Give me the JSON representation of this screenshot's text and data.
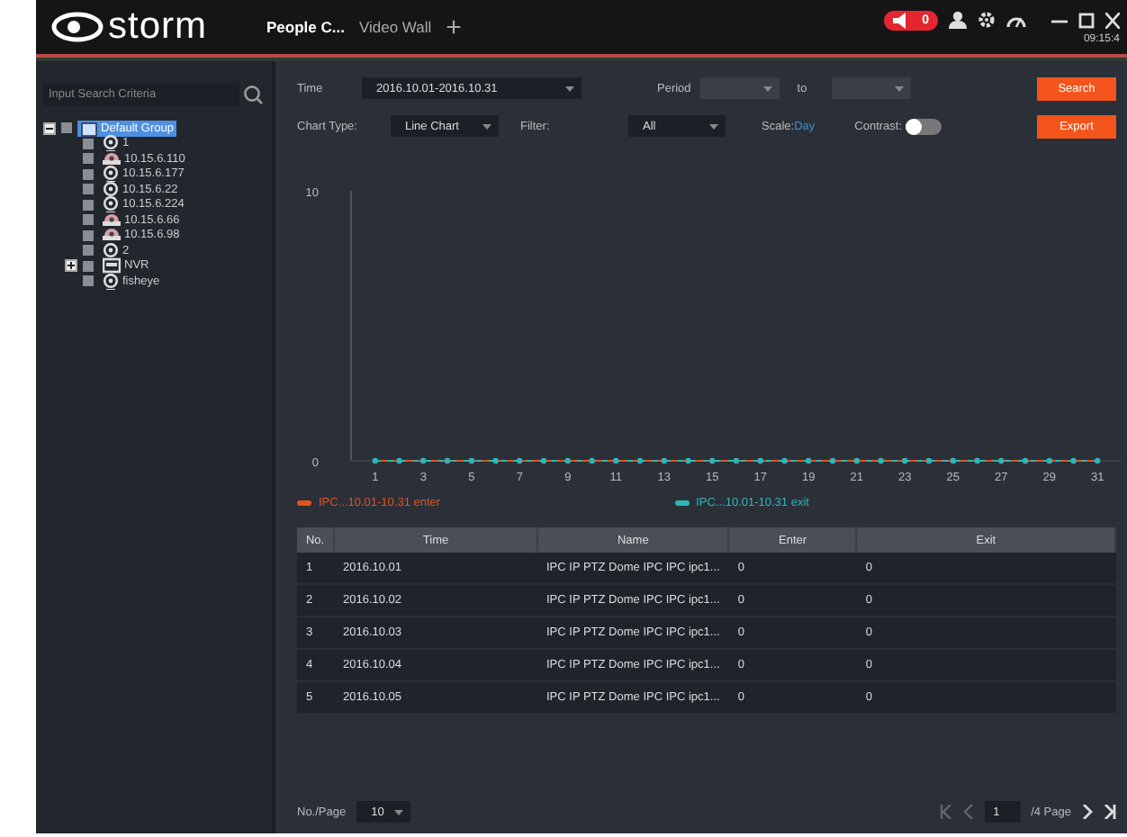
{
  "header": {
    "logo": "storm",
    "tabs": [
      {
        "label": "People C...",
        "selected": true
      },
      {
        "label": "Video Wall",
        "selected": false
      }
    ],
    "add_tab": "+",
    "alarm_count": "0",
    "clock": "09:15:4"
  },
  "sidebar": {
    "search": {
      "placeholder": "Input Search Criteria"
    },
    "tree": [
      {
        "label": "Default Group",
        "kind": "group",
        "expanded": true,
        "selected": true,
        "checked": false,
        "children": [
          {
            "label": "1",
            "kind": "ipc",
            "selected": false,
            "checked": false
          },
          {
            "label": "10.15.6.110",
            "kind": "ptz",
            "selected": false,
            "checked": false
          },
          {
            "label": "10.15.6.177",
            "kind": "ipc",
            "selected": false,
            "checked": false
          },
          {
            "label": "10.15.6.22",
            "kind": "ipc",
            "selected": false,
            "checked": false
          },
          {
            "label": "10.15.6.224",
            "kind": "ipc",
            "selected": false,
            "checked": false
          },
          {
            "label": "10.15.6.66",
            "kind": "ptz",
            "selected": false,
            "checked": false
          },
          {
            "label": "10.15.6.98",
            "kind": "ptz",
            "selected": false,
            "checked": false
          },
          {
            "label": "2",
            "kind": "ipc",
            "selected": false,
            "checked": false
          },
          {
            "label": "NVR",
            "kind": "nvr",
            "expanded": false,
            "selected": false,
            "checked": false
          },
          {
            "label": "fisheye",
            "kind": "ipc",
            "selected": false,
            "checked": false
          }
        ]
      }
    ]
  },
  "filters": {
    "time_label": "Time",
    "time_value": "2016.10.01-2016.10.31",
    "period_label": "Period",
    "to_label": "to",
    "search_button": "Search",
    "chart_type_label": "Chart Type:",
    "chart_type_value": "Line Chart",
    "filter_label": "Filter:",
    "filter_value": "All",
    "scale_label": "Scale:",
    "scale_value": "Day",
    "contrast_label": "Contrast:",
    "contrast_on": false,
    "export_button": "Export"
  },
  "chart": {
    "chart_data": {
      "type": "line",
      "legend": "bottom",
      "xlim": [
        0,
        32
      ],
      "x": [
        1,
        2,
        3,
        4,
        5,
        6,
        7,
        8,
        9,
        10,
        11,
        12,
        13,
        14,
        15,
        16,
        17,
        18,
        19,
        20,
        21,
        22,
        23,
        24,
        25,
        26,
        27,
        28,
        29,
        30,
        31
      ],
      "xticks": [
        1,
        3,
        5,
        7,
        9,
        11,
        13,
        15,
        17,
        19,
        21,
        23,
        25,
        27,
        29,
        31
      ],
      "yticks": [
        0,
        10
      ],
      "ylim": [
        0,
        10
      ],
      "series": [
        {
          "name": "IPC...10.01-10.31 enter",
          "color": "#e0541c",
          "line_style": "solid",
          "values": [
            0,
            0,
            0,
            0,
            0,
            0,
            0,
            0,
            0,
            0,
            0,
            0,
            0,
            0,
            0,
            0,
            0,
            0,
            0,
            0,
            0,
            0,
            0,
            0,
            0,
            0,
            0,
            0,
            0,
            0,
            0
          ]
        },
        {
          "name": "IPC...10.01-10.31 exit",
          "color": "#2fb5b8",
          "line_style": "dashed",
          "marker": "circle",
          "values": [
            0,
            0,
            0,
            0,
            0,
            0,
            0,
            0,
            0,
            0,
            0,
            0,
            0,
            0,
            0,
            0,
            0,
            0,
            0,
            0,
            0,
            0,
            0,
            0,
            0,
            0,
            0,
            0,
            0,
            0,
            0
          ]
        }
      ]
    }
  },
  "table": {
    "columns": [
      "No.",
      "Time",
      "Name",
      "Enter",
      "Exit"
    ],
    "rows": [
      [
        "1",
        "2016.10.01",
        "IPC IP PTZ Dome IPC IPC ipc1...",
        "0",
        "0"
      ],
      [
        "2",
        "2016.10.02",
        "IPC IP PTZ Dome IPC IPC ipc1...",
        "0",
        "0"
      ],
      [
        "3",
        "2016.10.03",
        "IPC IP PTZ Dome IPC IPC ipc1...",
        "0",
        "0"
      ],
      [
        "4",
        "2016.10.04",
        "IPC IP PTZ Dome IPC IPC ipc1...",
        "0",
        "0"
      ],
      [
        "5",
        "2016.10.05",
        "IPC IP PTZ Dome IPC IPC ipc1...",
        "0",
        "0"
      ]
    ]
  },
  "pager": {
    "per_page_label": "No./Page",
    "per_page_value": "10",
    "page": "1",
    "total": "/4 Page"
  }
}
